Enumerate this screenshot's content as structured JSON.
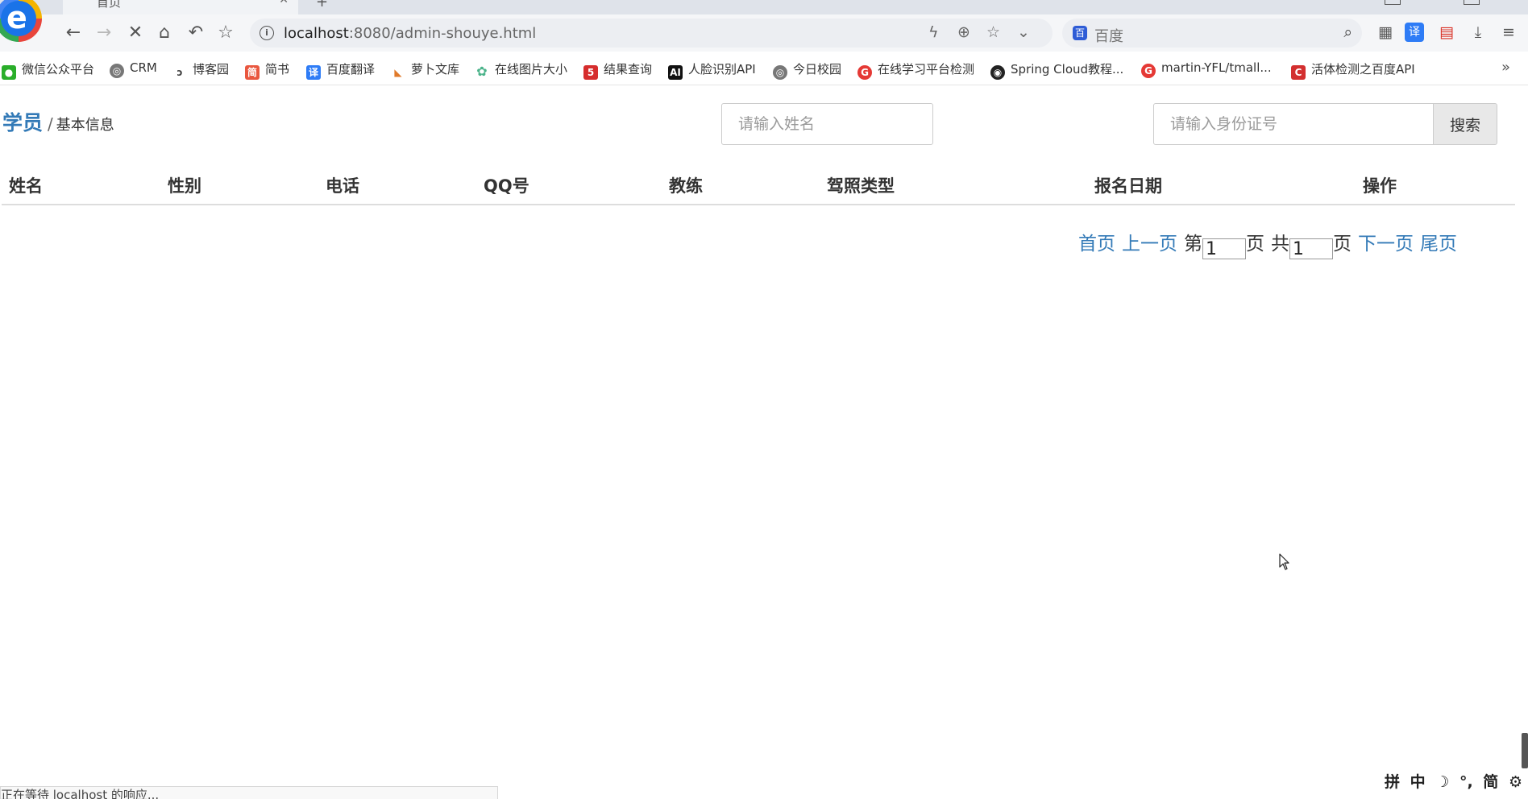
{
  "browser": {
    "tab_title": "首页",
    "url_host": "localhost",
    "url_path": ":8080/admin-shouye.html",
    "search_engine": "百度",
    "bookmarks": [
      {
        "label": "微信公众平台",
        "color": "#2aae2a"
      },
      {
        "label": "CRM",
        "color": "#555555"
      },
      {
        "label": "博客园",
        "color": "#555555"
      },
      {
        "label": "简书",
        "color": "#e9573f"
      },
      {
        "label": "百度翻译",
        "color": "#2e7cf6"
      },
      {
        "label": "萝卜文库",
        "color": "#e07a2a"
      },
      {
        "label": "在线图片大小",
        "color": "#4bb38a"
      },
      {
        "label": "结果查询",
        "color": "#d62d2d"
      },
      {
        "label": "人脸识别API",
        "color": "#111111"
      },
      {
        "label": "今日校园",
        "color": "#555555"
      },
      {
        "label": "在线学习平台检测",
        "color": "#e53935"
      },
      {
        "label": "Spring Cloud教程...",
        "color": "#222222"
      },
      {
        "label": "martin-YFL/tmall...",
        "color": "#e53935"
      },
      {
        "label": "活体检测之百度API",
        "color": "#d32f2f"
      }
    ],
    "bookmark_more": "»",
    "status_text": "正在等待 localhost 的响应..."
  },
  "page": {
    "breadcrumb": {
      "link": "学员",
      "separator": "/",
      "current": "基本信息"
    },
    "search": {
      "name_placeholder": "请输入姓名",
      "id_placeholder": "请输入身份证号",
      "button_label": "搜索"
    },
    "table": {
      "columns": [
        "姓名",
        "性别",
        "电话",
        "QQ号",
        "教练",
        "驾照类型",
        "报名日期",
        "操作"
      ],
      "rows": []
    },
    "pagination": {
      "first": "首页",
      "prev": "上一页",
      "page_prefix": "第",
      "current_page": "1",
      "page_suffix": "页",
      "total_prefix": "共",
      "total_pages": "1",
      "total_suffix": "页",
      "next": "下一页",
      "last": "尾页"
    }
  },
  "ime": {
    "items": [
      "拼",
      "中",
      "☽",
      "°,",
      "简",
      "⚙"
    ]
  }
}
